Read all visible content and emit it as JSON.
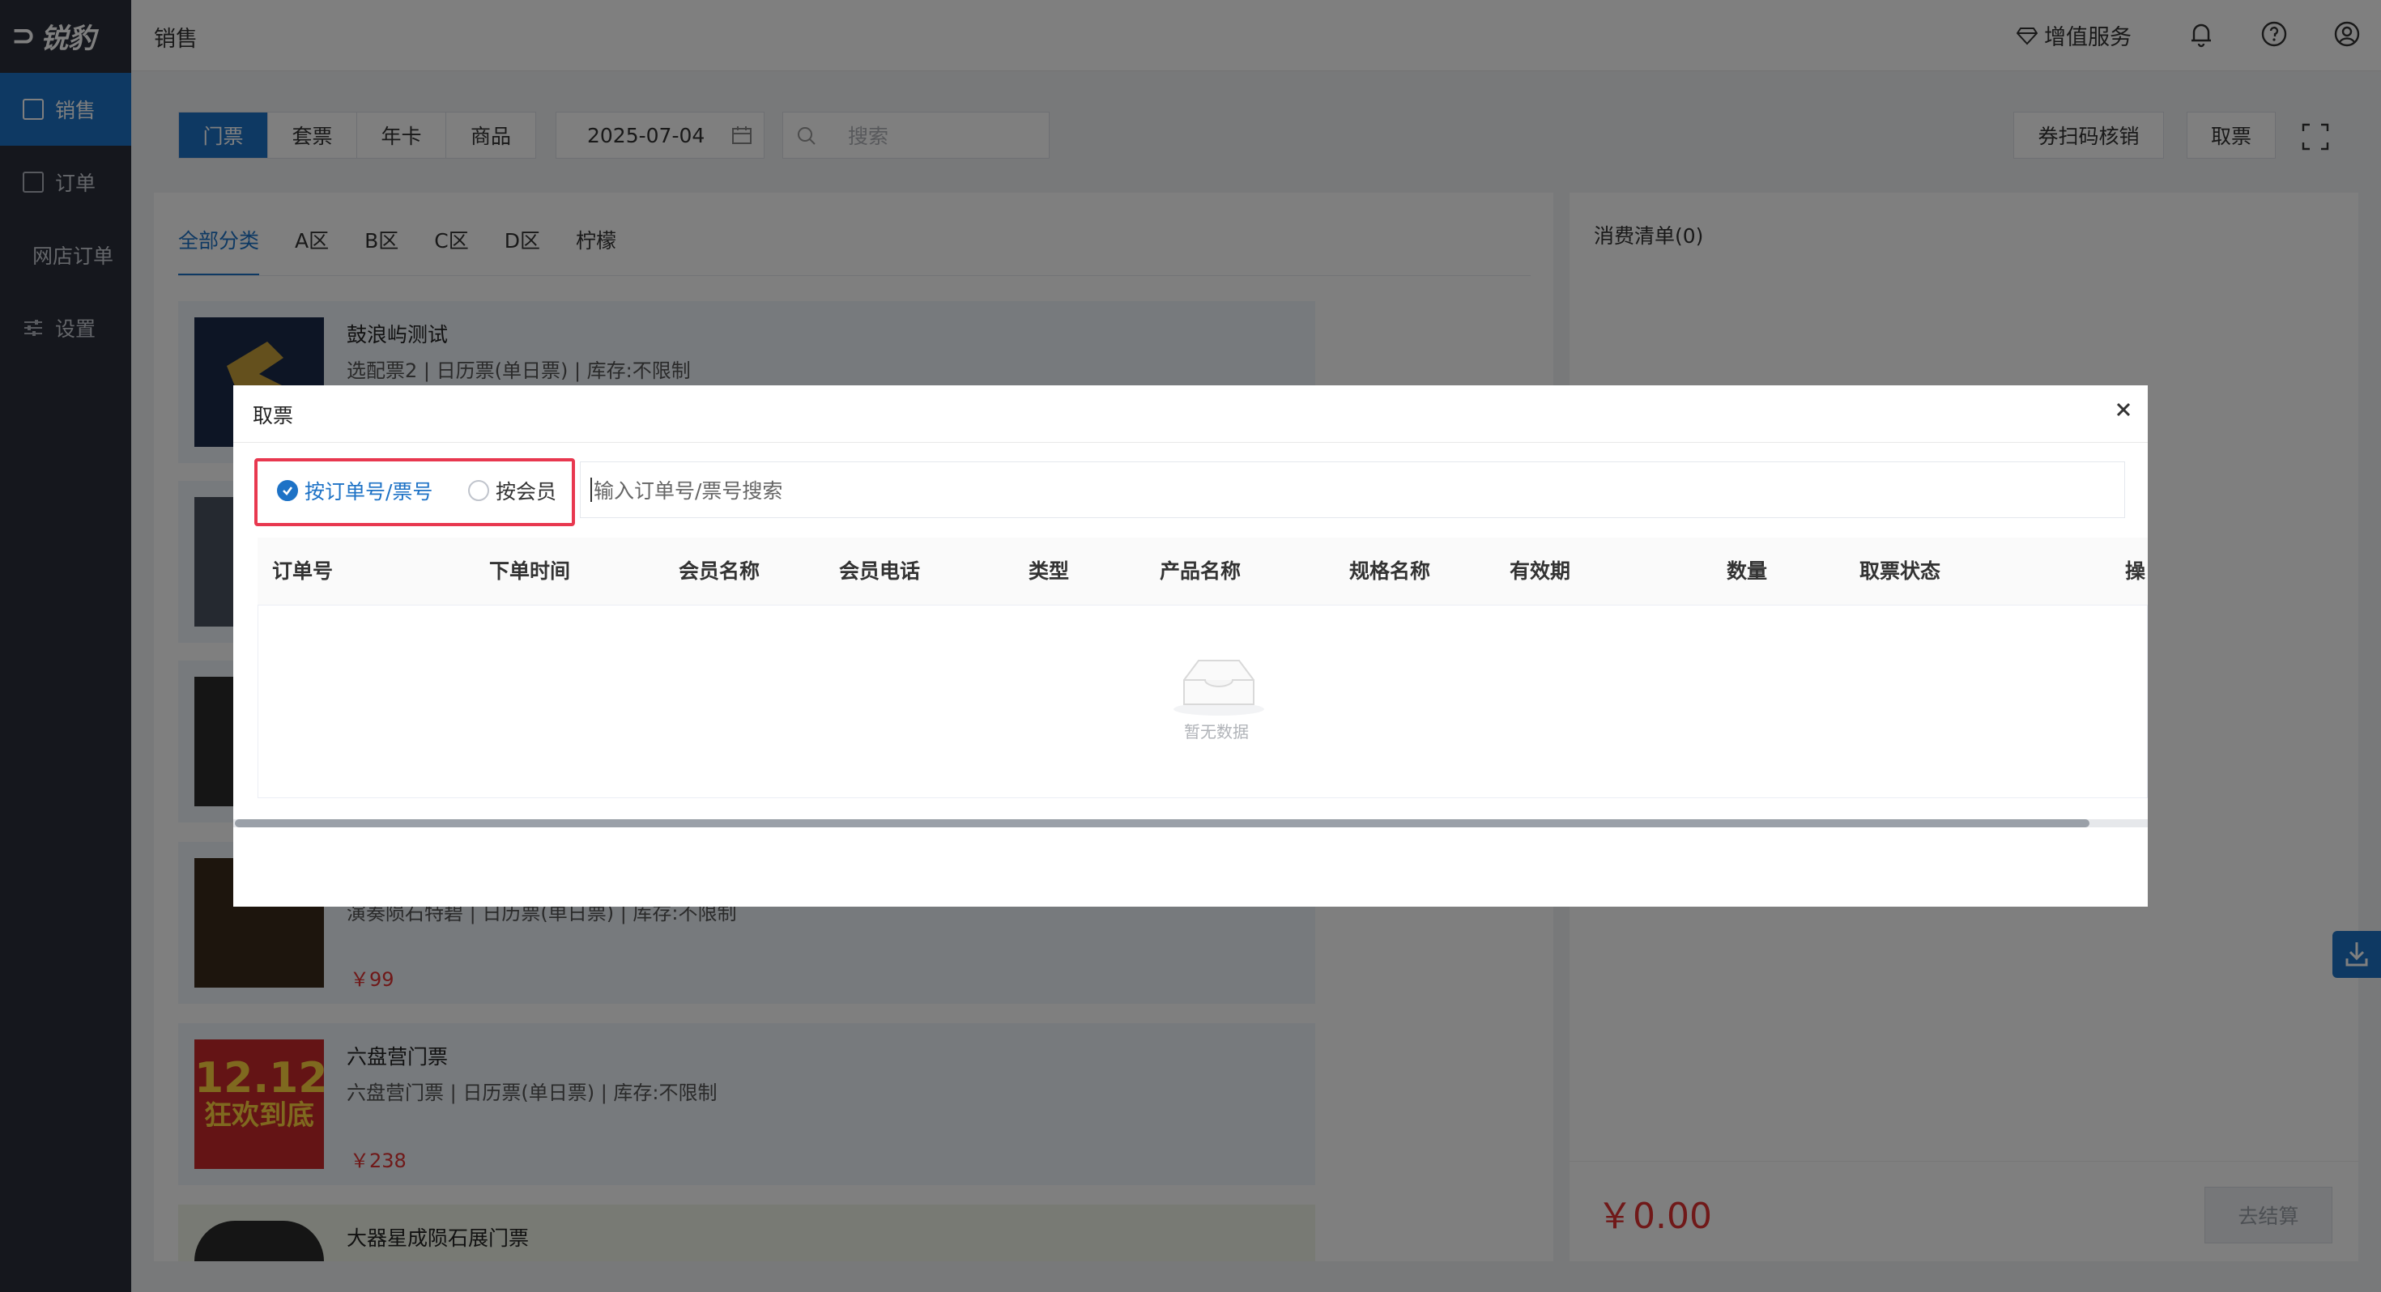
{
  "app": {
    "logo_text": "锐豹",
    "page_title": "销售"
  },
  "sidebar": {
    "items": [
      {
        "label": "销售",
        "active": true
      },
      {
        "label": "订单",
        "active": false
      },
      {
        "label": "网店订单",
        "active": false
      },
      {
        "label": "设置",
        "active": false
      }
    ]
  },
  "header": {
    "value_added": "增值服务",
    "icons": [
      "diamond-icon",
      "bell-icon",
      "help-icon",
      "user-icon"
    ]
  },
  "toolbar": {
    "tabs": [
      "门票",
      "套票",
      "年卡",
      "商品"
    ],
    "active_tab": "门票",
    "date": "2025-07-04",
    "search_placeholder": "搜索",
    "scan_label": "券扫码核销",
    "pickup_label": "取票"
  },
  "categories": {
    "tabs": [
      "全部分类",
      "A区",
      "B区",
      "C区",
      "D区",
      "柠檬"
    ],
    "active": "全部分类"
  },
  "products": [
    {
      "name": "鼓浪屿测试",
      "desc": "选配票2 | 日历票(单日票) | 库存:不限制",
      "price": ""
    },
    {
      "name": "",
      "desc": "演奏陨石特碧 | 日历票(单日票) | 库存:不限制",
      "price": "￥99"
    },
    {
      "name": "六盘营门票",
      "desc": "六盘营门票 | 日历票(单日票) | 库存:不限制",
      "price": "￥238"
    },
    {
      "name": "大器星成陨石展门票",
      "desc": "",
      "price": ""
    }
  ],
  "thumbnail_texts": {
    "promo_line1": "12.12",
    "promo_line2": "狂欢到底"
  },
  "cart": {
    "title": "消费清单(0)",
    "total": "￥0.00",
    "checkout_label": "去结算"
  },
  "modal": {
    "title": "取票",
    "modes": [
      {
        "label": "按订单号/票号",
        "checked": true
      },
      {
        "label": "按会员",
        "checked": false
      }
    ],
    "input_placeholder": "输入订单号/票号搜索",
    "columns": [
      "订单号",
      "下单时间",
      "会员名称",
      "会员电话",
      "类型",
      "产品名称",
      "规格名称",
      "有效期",
      "数量",
      "取票状态",
      "操"
    ],
    "empty_text": "暂无数据"
  },
  "colors": {
    "primary": "#1d72c6",
    "price_red": "#e03232",
    "highlight_border": "#e8384f",
    "sidebar_bg": "#2b2f3a"
  }
}
